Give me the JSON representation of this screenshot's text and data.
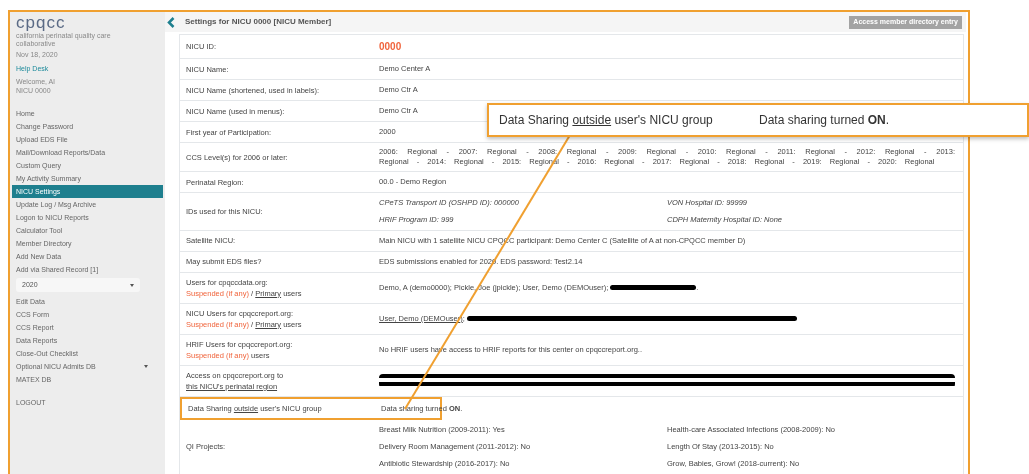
{
  "sidebar": {
    "logo": "cpqcc",
    "tagline": "california perinatal quality care collaborative",
    "date": "Nov 18, 2020",
    "help_link": "Help Desk",
    "welcome": [
      "Welcome, Al",
      "NICU 0000"
    ],
    "nav": [
      {
        "label": "Home",
        "selected": false
      },
      {
        "label": "Change Password",
        "selected": false
      },
      {
        "label": "Upload EDS File",
        "selected": false
      },
      {
        "label": "Mail/Download Reports/Data",
        "selected": false
      },
      {
        "label": "Custom Query",
        "selected": false
      },
      {
        "label": "My Activity Summary",
        "selected": false
      },
      {
        "label": "NICU Settings",
        "selected": true
      },
      {
        "label": "Update Log / Msg Archive",
        "selected": false
      },
      {
        "label": "Logon to NICU Reports",
        "selected": false
      },
      {
        "label": "Calculator Tool",
        "selected": false
      },
      {
        "label": "Member Directory",
        "selected": false
      },
      {
        "label": "Add New Data",
        "selected": false
      },
      {
        "label": "Add via Shared Record [1]",
        "selected": false
      }
    ],
    "year_select": {
      "value": "2020"
    },
    "nav2": [
      {
        "label": "Edit Data",
        "selected": false,
        "has_submenu": false
      },
      {
        "label": "CCS Form",
        "selected": false,
        "has_submenu": false
      },
      {
        "label": "CCS Report",
        "selected": false,
        "has_submenu": false
      },
      {
        "label": "Data Reports",
        "selected": false,
        "has_submenu": false
      },
      {
        "label": "Close-Out Checklist",
        "selected": false,
        "has_submenu": false
      },
      {
        "label": "Optional NICU Admits DB",
        "selected": false,
        "has_submenu": true
      },
      {
        "label": "MATEX DB",
        "selected": false,
        "has_submenu": false
      }
    ],
    "logout": "LOGOUT"
  },
  "header": {
    "title": "Settings for NICU 0000 [NICU Member]",
    "button": "Access member directory entry"
  },
  "rows": [
    {
      "label": [
        {
          "kind": "text",
          "text": "NICU ID:"
        }
      ],
      "kind": "id",
      "value": "0000",
      "highlighted": false
    },
    {
      "label": [
        {
          "kind": "text",
          "text": "NICU Name:"
        }
      ],
      "kind": "text",
      "value": "Demo Center A",
      "highlighted": false
    },
    {
      "label": [
        {
          "kind": "text",
          "text": "NICU Name (shortened, used in labels):"
        }
      ],
      "kind": "text",
      "value": "Demo Ctr A",
      "highlighted": false
    },
    {
      "label": [
        {
          "kind": "text",
          "text": "NICU Name (used in menus):"
        }
      ],
      "kind": "text",
      "value": "Demo Ctr A",
      "highlighted": false
    },
    {
      "label": [
        {
          "kind": "text",
          "text": "First year of Participation:"
        }
      ],
      "kind": "text",
      "value": "2000",
      "highlighted": false
    },
    {
      "label": [
        {
          "kind": "text",
          "text": "CCS Level(s) for 2006 or later:"
        }
      ],
      "kind": "justified",
      "value": "2006: Regional - 2007: Regional - 2008: Regional - 2009: Regional - 2010: Regional - 2011: Regional - 2012: Regional - 2013: Regional - 2014: Regional - 2015: Regional - 2016: Regional - 2017: Regional - 2018: Regional - 2019: Regional - 2020: Regional",
      "highlighted": false
    },
    {
      "label": [
        {
          "kind": "text",
          "text": "Perinatal Region:"
        }
      ],
      "kind": "text",
      "value": "00.0 - Demo Region",
      "highlighted": false
    },
    {
      "label": [
        {
          "kind": "text",
          "text": "IDs used for this NICU:"
        }
      ],
      "kind": "italic_grid",
      "items": [
        "CPeTS Transport ID (OSHPD ID): 000000",
        "VON Hospital ID: 99999",
        "HRIF Program ID: 999",
        "CDPH Maternity Hospital ID: None"
      ],
      "highlighted": false
    },
    {
      "label": [
        {
          "kind": "text",
          "text": "Satellite NICU:"
        }
      ],
      "kind": "text",
      "value": "Main NICU with 1 satellite NICU CPQCC participant: Demo Center C (Satellite of A at non-CPQCC member D)",
      "highlighted": false
    },
    {
      "label": [
        {
          "kind": "text",
          "text": "May submit EDS files?"
        }
      ],
      "kind": "text",
      "value": "EDS submissions enabled for 2020. EDS password: Test2.14",
      "highlighted": false
    },
    {
      "label": [
        {
          "kind": "line",
          "text": "Users for cpqccdata.org:"
        },
        {
          "kind": "warn",
          "text": "Suspended (if any)"
        },
        {
          "kind": "text",
          "text": "/"
        },
        {
          "kind": "link",
          "text": "Primary"
        },
        {
          "kind": "text",
          "text": "users"
        }
      ],
      "kind": "segments",
      "segments": [
        {
          "kind": "text",
          "text": "Demo, A (demo0000); Pickle, Joe (jpickle); User, Demo (DEMOuser);"
        },
        {
          "kind": "redacted"
        },
        {
          "kind": "text",
          "text": "."
        }
      ],
      "highlighted": false
    },
    {
      "label": [
        {
          "kind": "line",
          "text": "NICU Users for cpqccreport.org:"
        },
        {
          "kind": "warn",
          "text": "Suspended (if any)"
        },
        {
          "kind": "text",
          "text": "/"
        },
        {
          "kind": "link",
          "text": "Primary"
        },
        {
          "kind": "text",
          "text": "users"
        }
      ],
      "kind": "segments",
      "segments": [
        {
          "kind": "link",
          "text": "User, Demo (DEMOuser)"
        },
        {
          "kind": "text",
          "text": ";"
        },
        {
          "kind": "redacted_long"
        }
      ],
      "highlighted": false
    },
    {
      "label": [
        {
          "kind": "line",
          "text": "HRIF Users for cpqccreport.org:"
        },
        {
          "kind": "warn",
          "text": "Suspended (if any)"
        },
        {
          "kind": "text",
          "text": "users"
        }
      ],
      "kind": "text",
      "value": "No HRIF users have access to HRIF reports for this center on cpqccreport.org..",
      "highlighted": false
    },
    {
      "label": [
        {
          "kind": "text",
          "text": "Access on cpqccreport.org to"
        },
        {
          "kind": "link",
          "text": "this NICU's perinatal region"
        }
      ],
      "kind": "segments",
      "segments": [
        {
          "kind": "redacted_block"
        }
      ],
      "highlighted": false
    },
    {
      "label": [
        {
          "kind": "text",
          "text": "Data Sharing"
        },
        {
          "kind": "link",
          "text": "outside"
        },
        {
          "kind": "text",
          "text": "user's NICU group"
        }
      ],
      "kind": "rich",
      "value": "Data sharing turned **ON**.",
      "highlighted": true
    },
    {
      "label": [
        {
          "kind": "text",
          "text": "QI Projects:"
        }
      ],
      "kind": "grid",
      "items": [
        "Breast Milk Nutrition (2009-2011): Yes",
        "Health-care Associated Infections (2008-2009): No",
        "Delivery Room Management (2011-2012): No",
        "Length Of Stay (2013-2015): No",
        "Antibiotic Stewardship (2016-2017): No",
        "Grow, Babies, Grow! (2018-current): No"
      ],
      "highlighted": false
    }
  ],
  "callout": {
    "label": [
      {
        "kind": "text",
        "text": "Data Sharing"
      },
      {
        "kind": "link",
        "text": "outside"
      },
      {
        "kind": "text",
        "text": "user's NICU group"
      }
    ],
    "value": "Data sharing turned **ON**."
  }
}
